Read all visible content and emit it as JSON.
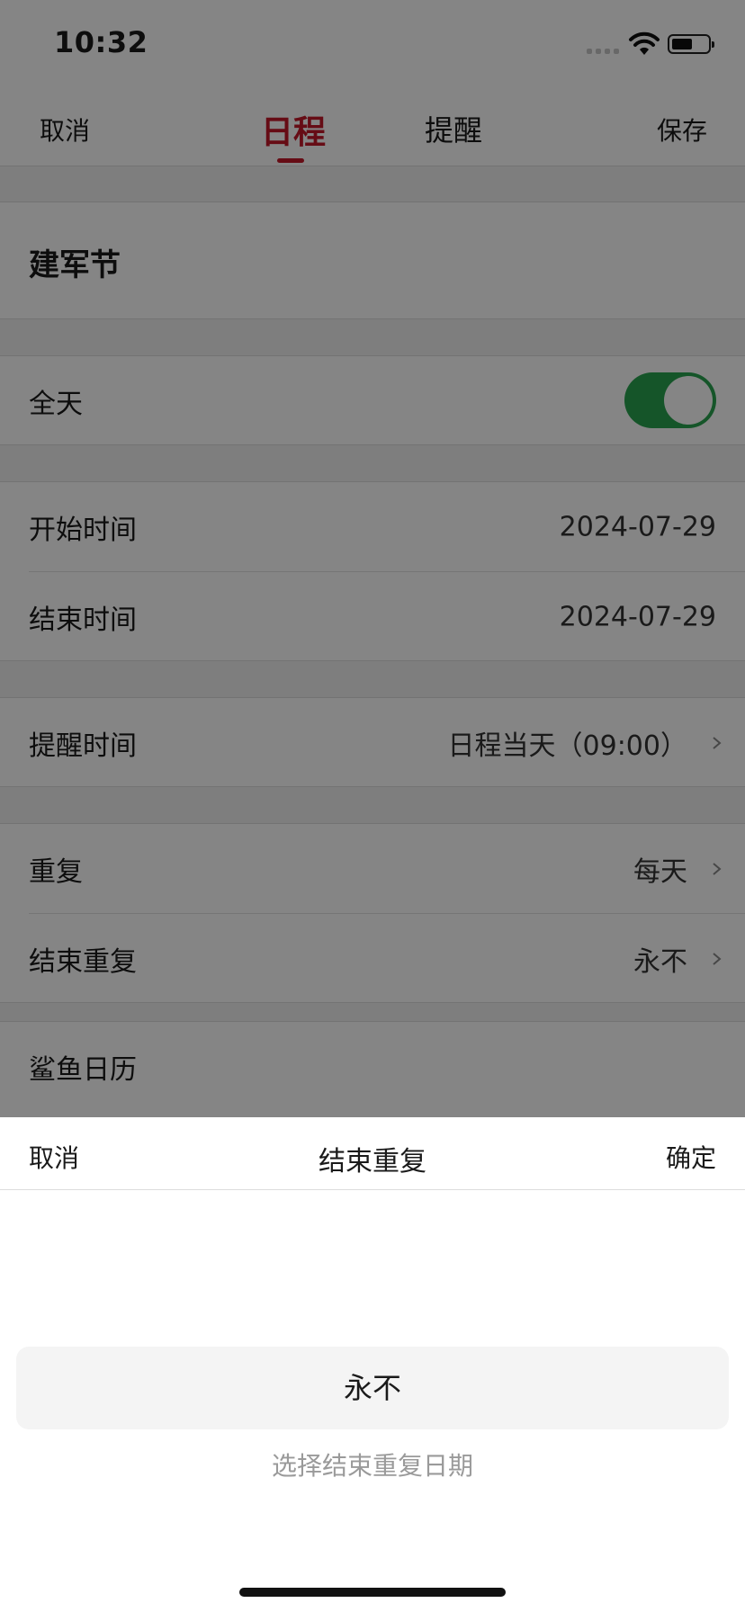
{
  "status_bar": {
    "time": "10:32"
  },
  "nav": {
    "cancel": "取消",
    "tabs": [
      "日程",
      "提醒"
    ],
    "save": "保存",
    "active_tab_color": "#c3182a"
  },
  "event": {
    "title": "建军节"
  },
  "all_day": {
    "label": "全天",
    "enabled": true,
    "toggle_color": "#2aa44f"
  },
  "times": {
    "start_label": "开始时间",
    "start_value": "2024-07-29",
    "end_label": "结束时间",
    "end_value": "2024-07-29"
  },
  "reminder": {
    "label": "提醒时间",
    "value": "日程当天（09:00）"
  },
  "repeat": {
    "label": "重复",
    "value": "每天",
    "end_label": "结束重复",
    "end_value": "永不"
  },
  "calendar": {
    "label": "鲨鱼日历"
  },
  "sheet": {
    "cancel": "取消",
    "title": "结束重复",
    "confirm": "确定",
    "never_option": "永不",
    "choose_date": "选择结束重复日期"
  }
}
